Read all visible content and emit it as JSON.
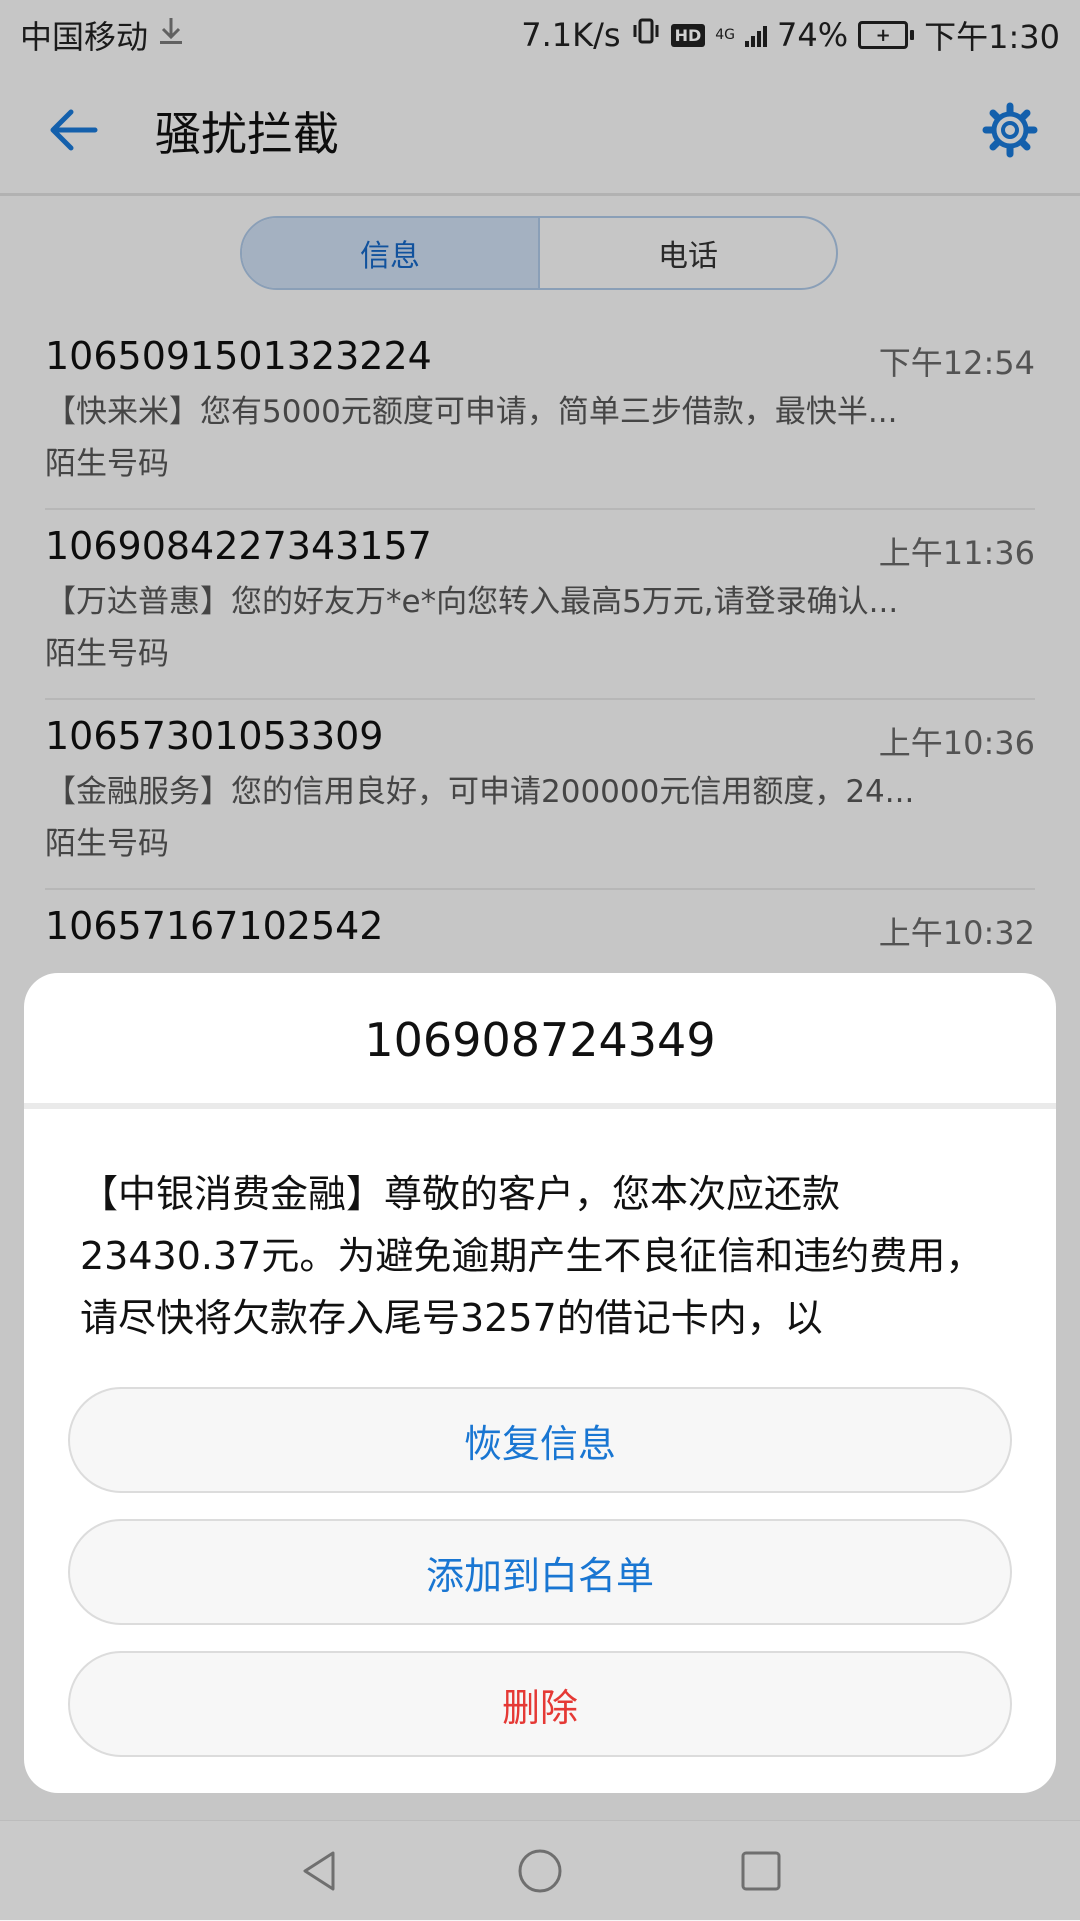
{
  "status_bar": {
    "carrier": "中国移动",
    "speed": "7.1K/s",
    "hd": "HD",
    "network": "4G",
    "battery": "74%",
    "time": "下午1:30"
  },
  "app_bar": {
    "title": "骚扰拦截"
  },
  "tabs": [
    {
      "label": "信息",
      "active": true
    },
    {
      "label": "电话",
      "active": false
    }
  ],
  "messages": [
    {
      "number": "1065091501323224",
      "time": "下午12:54",
      "preview": "【快来米】您有5000元额度可申请，简单三步借款，最快半...",
      "tag": "陌生号码"
    },
    {
      "number": "1069084227343157",
      "time": "上午11:36",
      "preview": "【万达普惠】您的好友万*e*向您转入最高5万元,请登录确认...",
      "tag": "陌生号码"
    },
    {
      "number": "10657301053309",
      "time": "上午10:36",
      "preview": "【金融服务】您的信用良好，可申请200000元信用额度，24...",
      "tag": "陌生号码"
    },
    {
      "number": "10657167102542",
      "time": "上午10:32",
      "preview": "",
      "tag": ""
    }
  ],
  "dialog": {
    "title": "106908724349",
    "body": "【中银消费金融】尊敬的客户，您本次应还款23430.37元。为避免逾期产生不良征信和违约费用，请尽快将欠款存入尾号3257的借记卡内，以",
    "buttons": {
      "restore": "恢复信息",
      "whitelist": "添加到白名单",
      "delete": "删除"
    }
  },
  "colors": {
    "accent": "#1976d2",
    "danger": "#e53935",
    "tab_active_bg": "#c9d8ec"
  }
}
